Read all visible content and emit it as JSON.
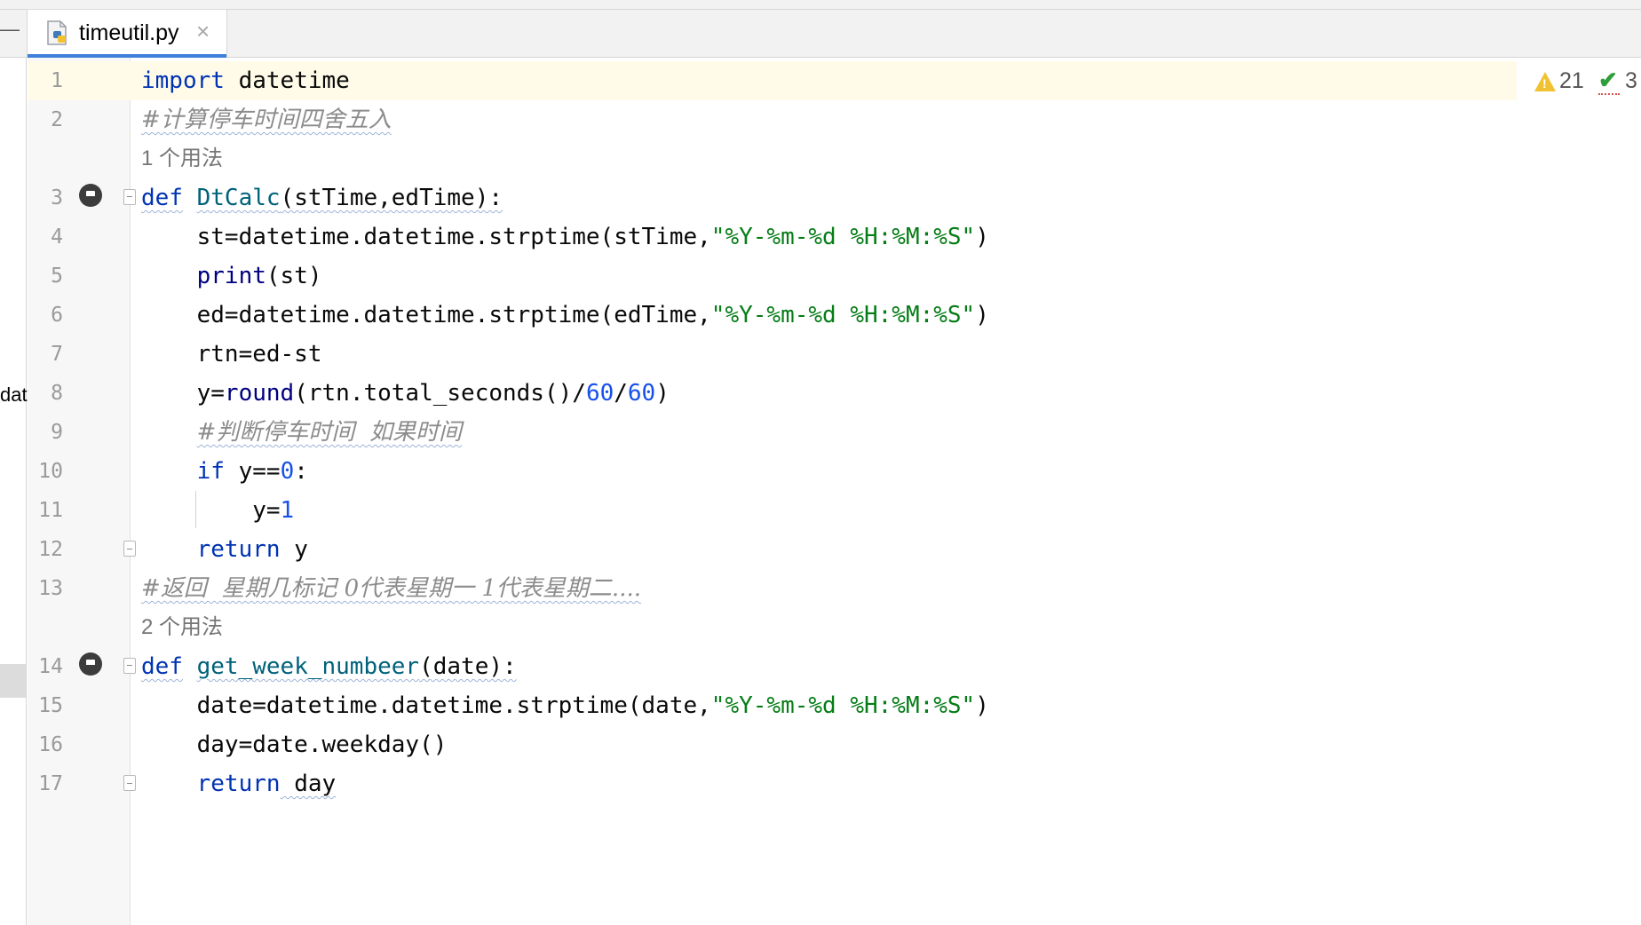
{
  "tab": {
    "filename": "timeutil.py",
    "close_glyph": "×",
    "icon": "python-file-icon"
  },
  "sidebar": {
    "partial_label": "dat"
  },
  "inspections": {
    "warnings": "21",
    "typos": "3"
  },
  "hints": {
    "usages_dtcalc": "1 个用法",
    "usages_week": "2 个用法"
  },
  "lines": {
    "n1": "1",
    "n2": "2",
    "n3": "3",
    "n4": "4",
    "n5": "5",
    "n6": "6",
    "n7": "7",
    "n8": "8",
    "n9": "9",
    "n10": "10",
    "n11": "11",
    "n12": "12",
    "n13": "13",
    "n14": "14",
    "n15": "15",
    "n16": "16",
    "n17": "17"
  },
  "code": {
    "import_kw": "import",
    "import_mod": " datetime",
    "c2": "#计算停车时间四舍五入",
    "def_kw": "def",
    "fn_dtcalc": "DtCalc",
    "params_dtcalc": "(stTime,edTime):",
    "l4_pre": "    st=datetime.datetime.strptime(stTime,",
    "fmt": "\"%Y-%m-%d %H:%M:%S\"",
    "close_paren": ")",
    "print_kw": "print",
    "l5_args": "(st)",
    "l6_pre": "    ed=datetime.datetime.strptime(edTime,",
    "l7": "    rtn=ed-st",
    "l8_pre": "    y=",
    "round_kw": "round",
    "l8_mid": "(rtn.total_seconds()/",
    "n60": "60",
    "slash": "/",
    "c9": "#判断停车时间  如果时间",
    "if_kw": "if",
    "l10_mid": " y==",
    "n0": "0",
    "colon": ":",
    "l11_pre": "        y=",
    "n1v": "1",
    "return_kw": "return",
    "ret_y": " y",
    "c13": "#返回  星期几标记 0代表星期一 1代表星期二....",
    "fn_week": "get_week_numbeer",
    "params_week": "(date):",
    "l15_pre": "    date=datetime.datetime.strptime(date,",
    "l16": "    day=date.weekday()",
    "ret_day": " day"
  },
  "colors": {
    "keyword": "#0033b3",
    "string": "#067d17",
    "number": "#1750eb",
    "comment": "#8c8c8c",
    "function": "#00627a",
    "builtin": "#000080",
    "current_line": "#fffbe8",
    "tab_accent": "#3d7fd9"
  }
}
